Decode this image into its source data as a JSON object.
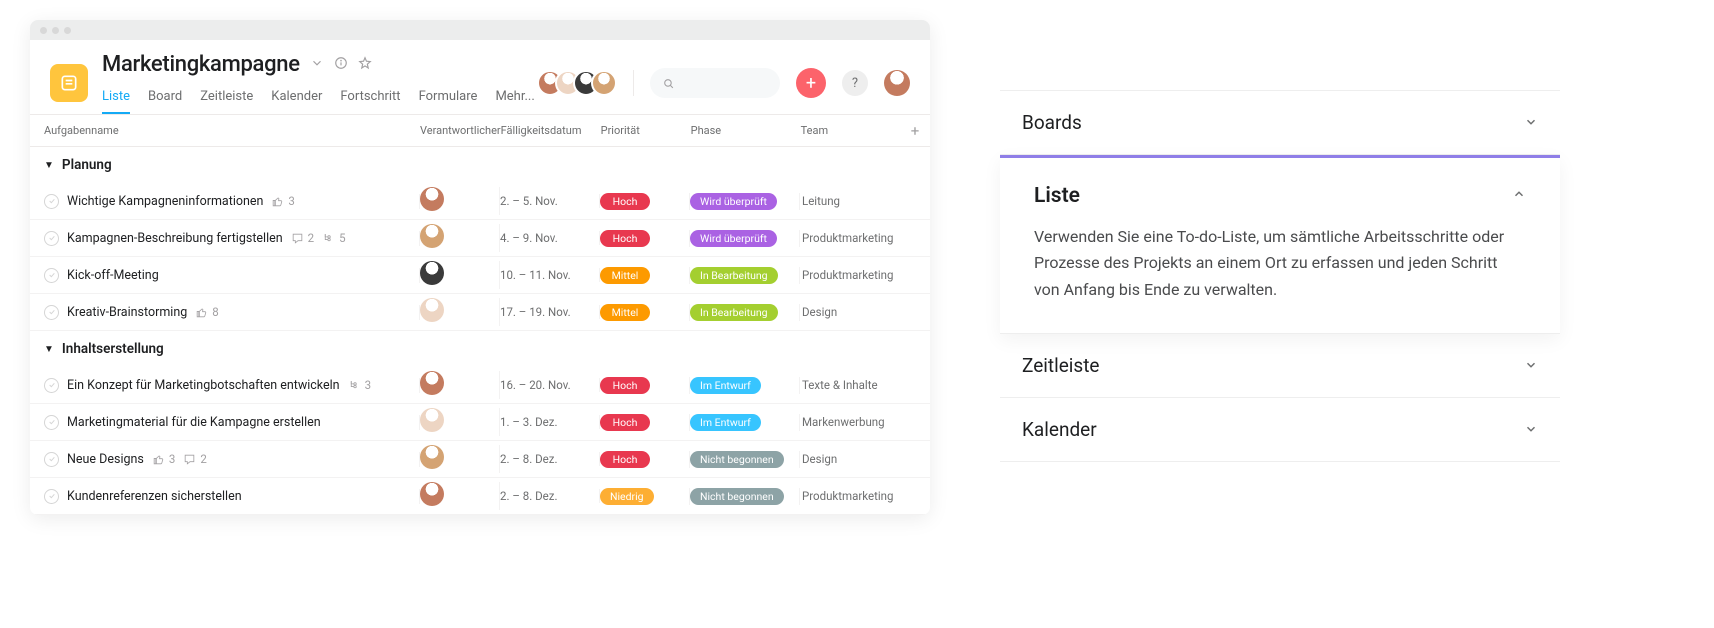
{
  "project": {
    "title": "Marketingkampagne",
    "tabs": [
      "Liste",
      "Board",
      "Zeitleiste",
      "Kalender",
      "Fortschritt",
      "Formulare",
      "Mehr..."
    ],
    "active_tab": 0,
    "avatars": [
      "#c47b5f",
      "#edd5c3",
      "#3a3a3a",
      "#d4a373"
    ]
  },
  "columns": {
    "name": "Aufgabenname",
    "owner": "Verantwortlicher",
    "due": "Fälligkeitsdatum",
    "prio": "Priorität",
    "phase": "Phase",
    "team": "Team",
    "add": "+"
  },
  "priority_colors": {
    "Hoch": "#e8384f",
    "Mittel": "#fd9a00",
    "Niedrig": "#fdae33"
  },
  "phase_colors": {
    "Wird überprüft": "#aa62e3",
    "In Bearbeitung": "#a4cf30",
    "Im Entwurf": "#37c5ff",
    "Nicht begonnen": "#8da3a6"
  },
  "sections": [
    {
      "title": "Planung",
      "rows": [
        {
          "name": "Wichtige Kampagneninformationen",
          "likes": 3,
          "comments": null,
          "subtasks": null,
          "owner": "#c47b5f",
          "due": "2. – 5. Nov.",
          "prio": "Hoch",
          "phase": "Wird überprüft",
          "team": "Leitung"
        },
        {
          "name": "Kampagnen-Beschreibung fertigstellen",
          "likes": null,
          "comments": 2,
          "subtasks": 5,
          "owner": "#d4a373",
          "due": "4. – 9. Nov.",
          "prio": "Hoch",
          "phase": "Wird überprüft",
          "team": "Produktmarketing"
        },
        {
          "name": "Kick-off-Meeting",
          "likes": null,
          "comments": null,
          "subtasks": null,
          "owner": "#3a3a3a",
          "due": "10. – 11. Nov.",
          "prio": "Mittel",
          "phase": "In Bearbeitung",
          "team": "Produktmarketing"
        },
        {
          "name": "Kreativ-Brainstorming",
          "likes": 8,
          "comments": null,
          "subtasks": null,
          "owner": "#edd5c3",
          "due": "17. – 19. Nov.",
          "prio": "Mittel",
          "phase": "In Bearbeitung",
          "team": "Design"
        }
      ]
    },
    {
      "title": "Inhaltserstellung",
      "rows": [
        {
          "name": "Ein Konzept für Marketingbotschaften entwickeln",
          "likes": null,
          "comments": null,
          "subtasks": 3,
          "owner": "#c47b5f",
          "due": "16. – 20. Nov.",
          "prio": "Hoch",
          "phase": "Im Entwurf",
          "team": "Texte & Inhalte"
        },
        {
          "name": "Marketingmaterial für die Kampagne erstellen",
          "likes": null,
          "comments": null,
          "subtasks": null,
          "owner": "#edd5c3",
          "due": "1. – 3. Dez.",
          "prio": "Hoch",
          "phase": "Im Entwurf",
          "team": "Markenwerbung"
        },
        {
          "name": "Neue Designs",
          "likes": 3,
          "comments": 2,
          "subtasks": null,
          "owner": "#d4a373",
          "due": "2. – 8. Dez.",
          "prio": "Hoch",
          "phase": "Nicht begonnen",
          "team": "Design"
        },
        {
          "name": "Kundenreferenzen sicherstellen",
          "likes": null,
          "comments": null,
          "subtasks": null,
          "owner": "#c47b5f",
          "due": "2. – 8. Dez.",
          "prio": "Niedrig",
          "phase": "Nicht begonnen",
          "team": "Produktmarketing"
        }
      ]
    }
  ],
  "search": {
    "placeholder": ""
  },
  "me_avatar": "#c47b5f",
  "accordion": {
    "items": [
      "Boards",
      "Liste",
      "Zeitleiste",
      "Kalender"
    ],
    "open_index": 1,
    "open_title": "Liste",
    "open_body": "Verwenden Sie eine To-do-Liste, um sämtliche Arbeitsschritte oder Prozesse des Projekts an einem Ort zu erfassen und jeden Schritt von Anfang bis Ende zu verwalten."
  }
}
